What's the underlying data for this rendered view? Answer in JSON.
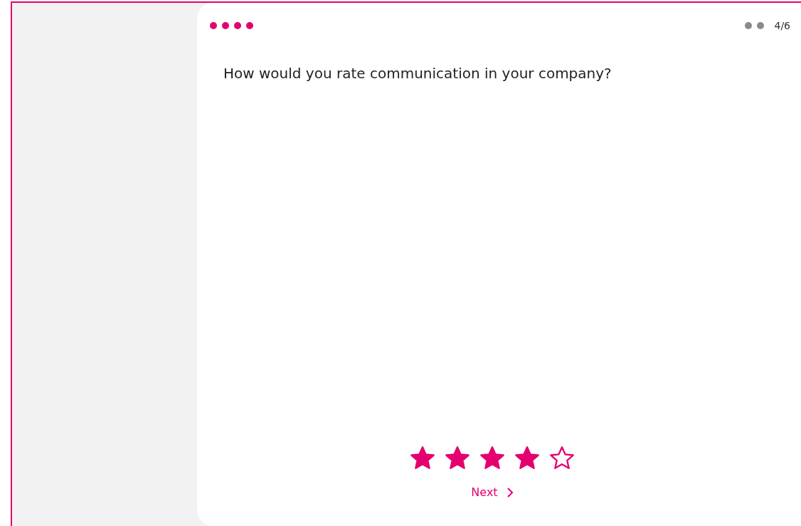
{
  "progress": {
    "steps": [
      {
        "completed": true
      },
      {
        "completed": true
      },
      {
        "completed": true
      },
      {
        "completed": true
      },
      {
        "completed": false
      },
      {
        "completed": false
      }
    ],
    "counter": "4/6"
  },
  "question": "How would you rate communication in your company?",
  "rating": {
    "stars": 4
  },
  "next_button": {
    "label": "Next"
  }
}
